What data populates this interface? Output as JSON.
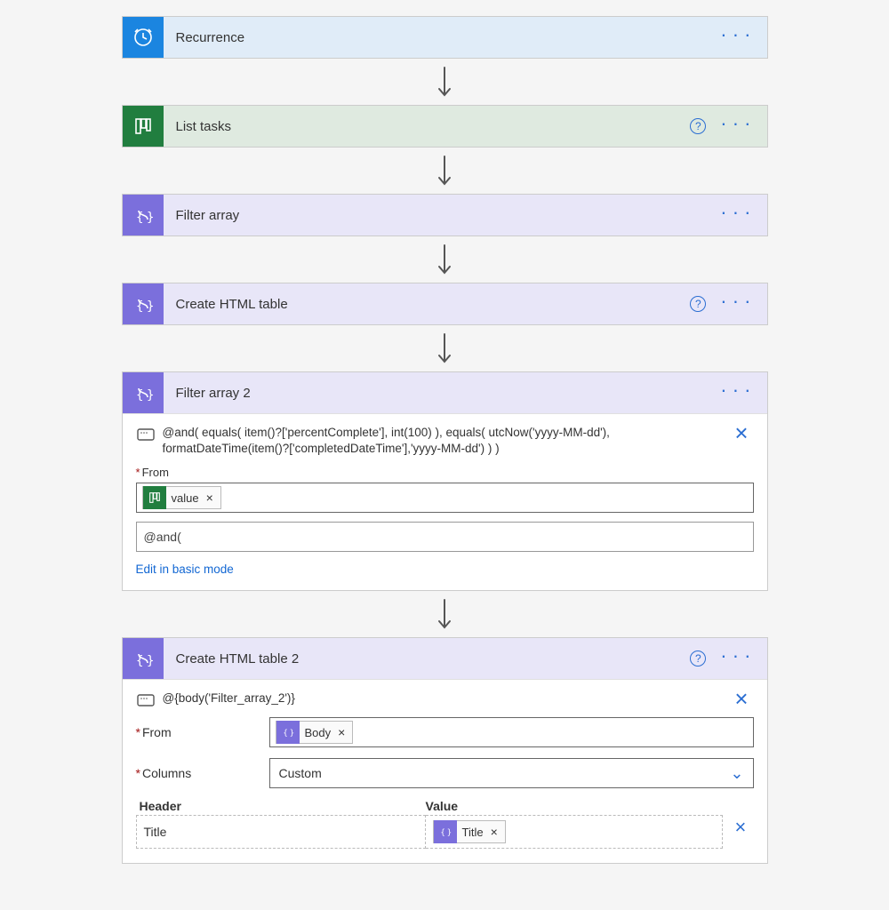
{
  "steps": {
    "recurrence": {
      "title": "Recurrence"
    },
    "listTasks": {
      "title": "List tasks"
    },
    "filterArray": {
      "title": "Filter array"
    },
    "createTable": {
      "title": "Create HTML table"
    },
    "filterArray2": {
      "title": "Filter array 2",
      "peek": "@and( equals( item()?['percentComplete'], int(100) ), equals( utcNow('yyyy-MM-dd'), formatDateTime(item()?['completedDateTime'],'yyyy-MM-dd') ) )",
      "fromLabel": "From",
      "fromToken": "value",
      "expressionInput": "@and(",
      "editModeLink": "Edit in basic mode"
    },
    "createTable2": {
      "title": "Create HTML table 2",
      "peek": "@{body('Filter_array_2')}",
      "fromLabel": "From",
      "fromToken": "Body",
      "columnsLabel": "Columns",
      "columnsValue": "Custom",
      "headerLabel": "Header",
      "valueLabel": "Value",
      "row1Header": "Title",
      "row1Token": "Title"
    }
  }
}
